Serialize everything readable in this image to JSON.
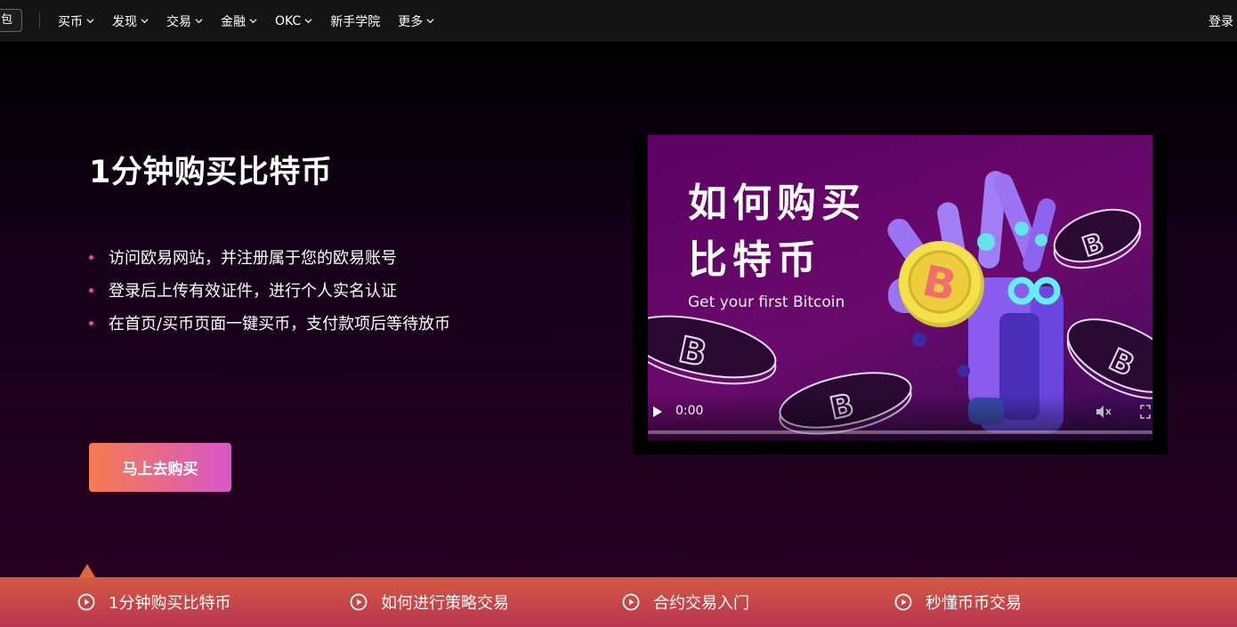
{
  "nav": {
    "wallet_label": "包",
    "items": [
      {
        "label": "买币"
      },
      {
        "label": "发现"
      },
      {
        "label": "交易"
      },
      {
        "label": "金融"
      },
      {
        "label": "OKC"
      },
      {
        "label": "新手学院"
      },
      {
        "label": "更多"
      }
    ],
    "login_label": "登录"
  },
  "hero": {
    "title": "1分钟购买比特币",
    "steps": [
      "访问欧易网站，并注册属于您的欧易账号",
      "登录后上传有效证件，进行个人实名认证",
      "在首页/买币页面一键买币，支付款项后等待放币"
    ],
    "cta_label": "马上去购买",
    "bullet_color": "#e84a9c"
  },
  "video": {
    "poster_title_line1": "如何购买",
    "poster_title_line2": "比特币",
    "poster_subtitle": "Get your first Bitcoin",
    "current_time": "0:00",
    "progress": 0
  },
  "tabs": [
    {
      "label": "1分钟购买比特币",
      "active": true
    },
    {
      "label": "如何进行策略交易",
      "active": false
    },
    {
      "label": "合约交易入门",
      "active": false
    },
    {
      "label": "秒懂币币交易",
      "active": false
    }
  ],
  "colors": {
    "accent_gradient_start": "#f47b4e",
    "accent_gradient_end": "#d957c9",
    "tabbar_start": "#d55a43",
    "tabbar_end": "#b8344f"
  }
}
